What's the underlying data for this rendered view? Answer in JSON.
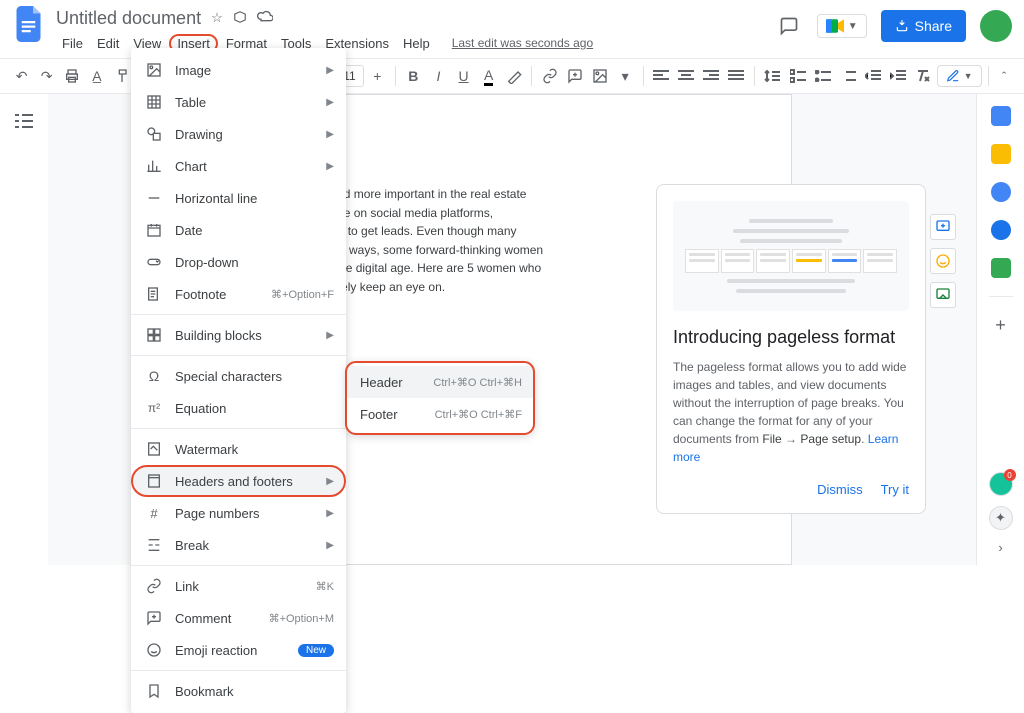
{
  "header": {
    "title": "Untitled document",
    "menus": [
      "File",
      "Edit",
      "View",
      "Insert",
      "Format",
      "Tools",
      "Extensions",
      "Help"
    ],
    "last_edit": "Last edit was seconds ago",
    "share_label": "Share"
  },
  "toolbar": {
    "font_size": "11"
  },
  "insert_menu": {
    "items": [
      {
        "icon": "image-icon",
        "label": "Image",
        "submenu": true
      },
      {
        "icon": "table-icon",
        "label": "Table",
        "submenu": true
      },
      {
        "icon": "drawing-icon",
        "label": "Drawing",
        "submenu": true
      },
      {
        "icon": "chart-icon",
        "label": "Chart",
        "submenu": true
      },
      {
        "icon": "hr-icon",
        "label": "Horizontal line"
      },
      {
        "icon": "date-icon",
        "label": "Date"
      },
      {
        "icon": "dropdown-icon",
        "label": "Drop-down"
      },
      {
        "icon": "footnote-icon",
        "label": "Footnote",
        "kb": "⌘+Option+F"
      },
      {
        "separator": true
      },
      {
        "icon": "blocks-icon",
        "label": "Building blocks",
        "submenu": true
      },
      {
        "separator": true
      },
      {
        "icon": "special-icon",
        "label": "Special characters"
      },
      {
        "icon": "equation-icon",
        "label": "Equation"
      },
      {
        "separator": true
      },
      {
        "icon": "watermark-icon",
        "label": "Watermark"
      },
      {
        "icon": "headers-icon",
        "label": "Headers and footers",
        "submenu": true,
        "highlight": true,
        "hover": true
      },
      {
        "icon": "pagenum-icon",
        "label": "Page numbers",
        "submenu": true
      },
      {
        "icon": "break-icon",
        "label": "Break",
        "submenu": true
      },
      {
        "separator": true
      },
      {
        "icon": "link-icon",
        "label": "Link",
        "kb": "⌘K"
      },
      {
        "icon": "comment-icon",
        "label": "Comment",
        "kb": "⌘+Option+M"
      },
      {
        "icon": "emoji-icon",
        "label": "Emoji reaction",
        "badge": "New"
      },
      {
        "separator": true
      },
      {
        "icon": "bookmark-icon",
        "label": "Bookmark"
      }
    ]
  },
  "submenu": {
    "items": [
      {
        "label": "Header",
        "kb": "Ctrl+⌘O Ctrl+⌘H",
        "hover": true
      },
      {
        "label": "Footer",
        "kb": "Ctrl+⌘O Ctrl+⌘F"
      }
    ]
  },
  "document_text": "ne more and more important in the real estate\nness is done on social media platforms,\n a good way to get leads. Even though many\n-and-mortar ways, some forward-thinking women\n market in the digital age. Here are 5 women who\nould definitely keep an eye on.",
  "promo": {
    "title": "Introducing pageless format",
    "body_pre": "The pageless format allows you to add wide images and tables, and view documents without the interruption of page breaks. You can change the format for any of your documents from ",
    "bold1": "File",
    "arrow": " → ",
    "bold2": "Page setup",
    "body_post": ". ",
    "learn": "Learn more",
    "dismiss": "Dismiss",
    "try": "Try it"
  }
}
